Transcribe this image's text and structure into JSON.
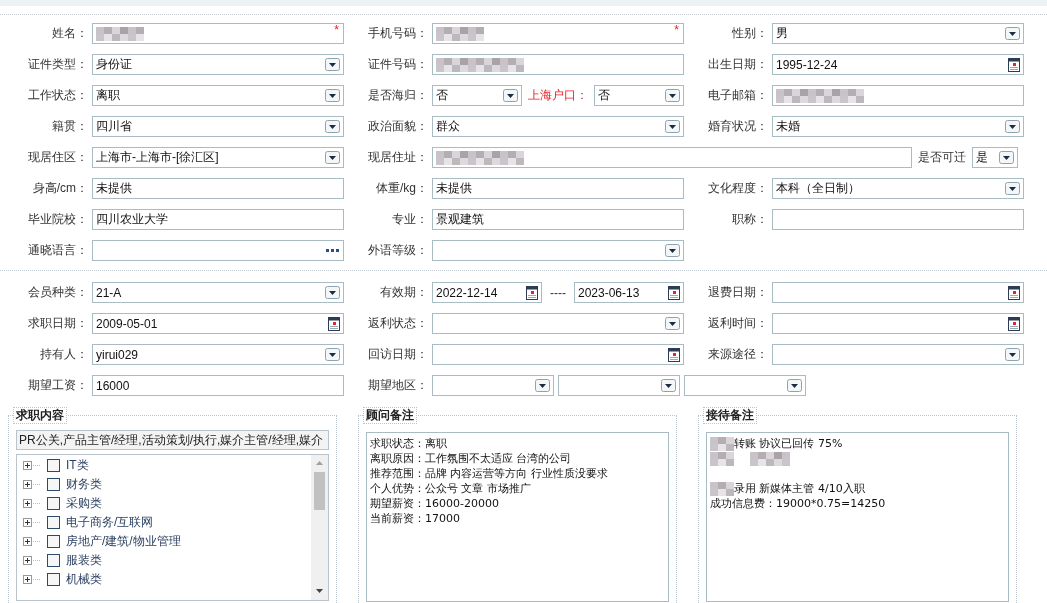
{
  "sections": [
    {
      "rows": [
        {
          "cells": [
            {
              "label": "姓名：",
              "items": [
                {
                  "kind": "text",
                  "redacted": true,
                  "required_mark": "*"
                }
              ]
            },
            {
              "label": "手机号码：",
              "items": [
                {
                  "kind": "text",
                  "redacted": true,
                  "required_mark": "*"
                }
              ]
            },
            {
              "label": "性别：",
              "items": [
                {
                  "kind": "select",
                  "value": "男"
                }
              ]
            }
          ]
        },
        {
          "cells": [
            {
              "label": "证件类型：",
              "items": [
                {
                  "kind": "select",
                  "value": "身份证"
                }
              ]
            },
            {
              "label": "证件号码：",
              "items": [
                {
                  "kind": "text",
                  "redacted": true
                }
              ]
            },
            {
              "label": "出生日期：",
              "items": [
                {
                  "kind": "date",
                  "value": "1995-12-24"
                }
              ]
            }
          ]
        },
        {
          "cells": [
            {
              "label": "工作状态：",
              "items": [
                {
                  "kind": "select",
                  "value": "离职"
                }
              ]
            },
            {
              "label": "是否海归：",
              "items": [
                {
                  "kind": "select",
                  "value": "否"
                },
                {
                  "kind": "label",
                  "text": "上海户口：",
                  "alert": true
                },
                {
                  "kind": "select",
                  "value": "否"
                }
              ]
            },
            {
              "label": "电子邮箱：",
              "items": [
                {
                  "kind": "text",
                  "redacted": true
                }
              ]
            }
          ]
        },
        {
          "cells": [
            {
              "label": "籍贯：",
              "items": [
                {
                  "kind": "select",
                  "value": "四川省"
                }
              ]
            },
            {
              "label": "政治面貌：",
              "items": [
                {
                  "kind": "select",
                  "value": "群众"
                }
              ]
            },
            {
              "label": "婚育状况：",
              "items": [
                {
                  "kind": "select",
                  "value": "未婚"
                }
              ]
            }
          ]
        },
        {
          "cells": [
            {
              "label": "现居住区：",
              "items": [
                {
                  "kind": "select",
                  "value": "上海市-上海市-[徐汇区]"
                }
              ]
            },
            {
              "label": "现居住址：",
              "items": [
                {
                  "kind": "text",
                  "redacted": true
                },
                {
                  "kind": "label",
                  "text": "是否可迁",
                  "alert": false
                },
                {
                  "kind": "select",
                  "value": "是"
                }
              ]
            }
          ]
        },
        {
          "cells": [
            {
              "label": "身高/cm：",
              "items": [
                {
                  "kind": "text",
                  "value": "未提供"
                }
              ]
            },
            {
              "label": "体重/kg：",
              "items": [
                {
                  "kind": "text",
                  "value": "未提供"
                }
              ]
            },
            {
              "label": "文化程度：",
              "items": [
                {
                  "kind": "select",
                  "value": "本科（全日制）"
                }
              ]
            }
          ]
        },
        {
          "cells": [
            {
              "label": "毕业院校：",
              "items": [
                {
                  "kind": "text",
                  "value": "四川农业大学"
                }
              ]
            },
            {
              "label": "专业：",
              "items": [
                {
                  "kind": "text",
                  "value": "景观建筑"
                }
              ]
            },
            {
              "label": "职称：",
              "items": [
                {
                  "kind": "text"
                }
              ]
            }
          ]
        },
        {
          "cells": [
            {
              "label": "通晓语言：",
              "items": [
                {
                  "kind": "picker"
                }
              ]
            },
            {
              "label": "外语等级：",
              "items": [
                {
                  "kind": "select"
                }
              ]
            }
          ]
        }
      ]
    },
    {
      "rows": [
        {
          "cells": [
            {
              "label": "会员种类：",
              "items": [
                {
                  "kind": "select",
                  "value": "21-A"
                }
              ]
            },
            {
              "label": "有效期：",
              "items": [
                {
                  "kind": "date",
                  "value": "2022-12-14"
                },
                {
                  "kind": "dash",
                  "text": "----"
                },
                {
                  "kind": "date",
                  "value": "2023-06-13"
                }
              ]
            },
            {
              "label": "退费日期：",
              "items": [
                {
                  "kind": "date"
                }
              ]
            }
          ]
        },
        {
          "cells": [
            {
              "label": "求职日期：",
              "items": [
                {
                  "kind": "date",
                  "value": "2009-05-01"
                }
              ]
            },
            {
              "label": "返利状态：",
              "items": [
                {
                  "kind": "select"
                }
              ]
            },
            {
              "label": "返利时间：",
              "items": [
                {
                  "kind": "date"
                }
              ]
            }
          ]
        },
        {
          "cells": [
            {
              "label": "持有人：",
              "items": [
                {
                  "kind": "select",
                  "value": "yirui029"
                }
              ]
            },
            {
              "label": "回访日期：",
              "items": [
                {
                  "kind": "date"
                }
              ]
            },
            {
              "label": "来源途径：",
              "items": [
                {
                  "kind": "select"
                }
              ]
            }
          ]
        },
        {
          "cells": [
            {
              "label": "期望工资：",
              "items": [
                {
                  "kind": "text",
                  "value": "16000"
                }
              ]
            },
            {
              "label": "期望地区：",
              "items": [
                {
                  "kind": "select"
                },
                {
                  "kind": "select"
                },
                {
                  "kind": "select"
                }
              ]
            }
          ]
        }
      ]
    }
  ],
  "job_panel": {
    "legend": "求职内容",
    "summary": "PR公关,产品主管/经理,活动策划/执行,媒介主管/经理,媒介",
    "tree": [
      {
        "label": "IT类",
        "checked": false,
        "expanded": false
      },
      {
        "label": "财务类",
        "checked": false,
        "expanded": false
      },
      {
        "label": "采购类",
        "checked": false,
        "expanded": false
      },
      {
        "label": "电子商务/互联网",
        "checked": false,
        "expanded": false
      },
      {
        "label": "房地产/建筑/物业管理",
        "checked": false,
        "expanded": false
      },
      {
        "label": "服装类",
        "checked": false,
        "expanded": false
      },
      {
        "label": "机械类",
        "checked": false,
        "expanded": false
      }
    ]
  },
  "consultant_notes": {
    "legend": "顾问备注",
    "lines": [
      {
        "kind": "text",
        "text": "求职状态：离职"
      },
      {
        "kind": "text",
        "text": "离职原因：工作氛围不太适应 台湾的公司"
      },
      {
        "kind": "text",
        "text": "推荐范围：品牌 内容运营等方向 行业性质没要求"
      },
      {
        "kind": "text",
        "text": "个人优势：公众号 文章 市场推广"
      },
      {
        "kind": "text",
        "text": "期望薪资：16000-20000"
      },
      {
        "kind": "text",
        "text": "当前薪资：17000"
      }
    ]
  },
  "reception_notes": {
    "legend": "接待备注",
    "lines": [
      {
        "kind": "text",
        "redacted": true,
        "text": "转账 协议已回传  75%"
      },
      {
        "kind": "redacted"
      },
      {
        "kind": "blank"
      },
      {
        "kind": "text",
        "redacted": true,
        "text": "录用 新媒体主管 4/10入职"
      },
      {
        "kind": "text",
        "text": "成功信息费：19000*0.75=14250"
      }
    ]
  }
}
